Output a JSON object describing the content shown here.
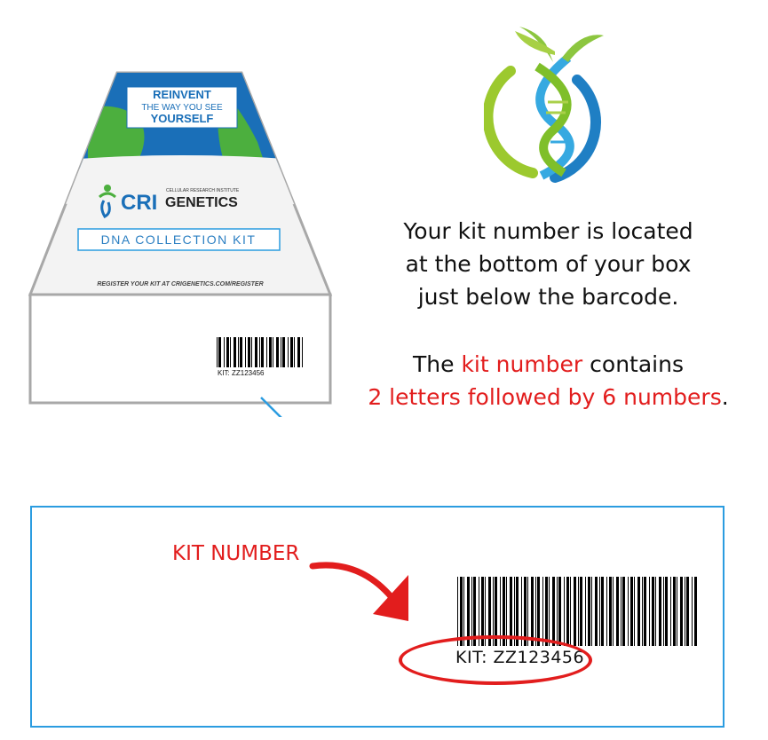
{
  "box": {
    "banner_line1": "REINVENT",
    "banner_line2": "THE WAY YOU SEE",
    "banner_line3": "YOURSELF",
    "brand_cri": "CRI",
    "brand_small": "CELLULAR RESEARCH INSTITUTE",
    "brand_genetics": "GENETICS",
    "kit_button": "DNA COLLECTION KIT",
    "register_text": "REGISTER YOUR KIT AT CRIGENETICS.COM/REGISTER",
    "kit_code_small": "KIT: ZZ123456"
  },
  "info": {
    "line1": "Your kit number is located",
    "line2": "at the bottom of your box",
    "line3": "just below the barcode.",
    "line4_prefix": "The ",
    "line4_highlight": "kit number",
    "line4_suffix": " contains",
    "line5_highlight": "2 letters followed by 6 numbers",
    "line5_suffix": "."
  },
  "zoom": {
    "label": "KIT NUMBER",
    "kit_code": "KIT: ZZ123456"
  },
  "colors": {
    "accent_red": "#e21d1d",
    "accent_blue": "#2b9ce0",
    "banner_blue": "#1a6fb8"
  }
}
